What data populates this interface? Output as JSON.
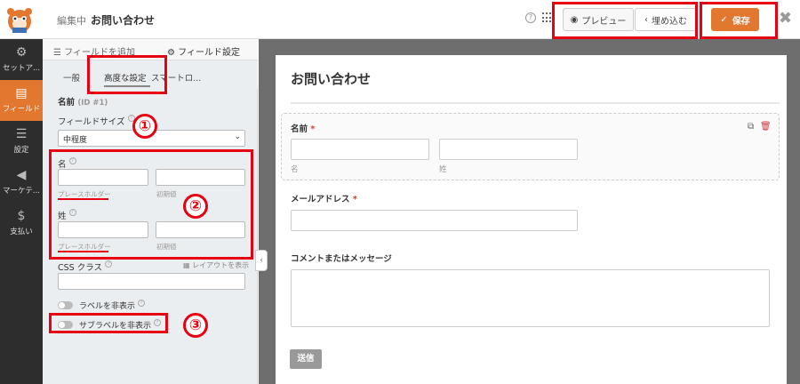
{
  "topbar": {
    "title_prefix": "編集中",
    "title": "お問い合わせ",
    "help_icon": "?",
    "preview_label": "プレビュー",
    "embed_label": "埋め込む",
    "save_label": "保存",
    "close_glyph": "✖"
  },
  "leftnav": {
    "items": [
      {
        "label": "セットアップ",
        "icon": "gear-icon",
        "glyph": "⚙"
      },
      {
        "label": "フィールド",
        "icon": "fields-icon",
        "glyph": "▤"
      },
      {
        "label": "設定",
        "icon": "sliders-icon",
        "glyph": "☰"
      },
      {
        "label": "マーケティング",
        "icon": "megaphone-icon",
        "glyph": "📢"
      },
      {
        "label": "支払い",
        "icon": "dollar-icon",
        "glyph": "$"
      }
    ]
  },
  "panel": {
    "tab_add": "フィールドを追加",
    "tab_settings": "フィールド設定",
    "subtabs": [
      "一般",
      "高度な設定",
      "スマートロ..."
    ],
    "field_name": "名前",
    "field_id": "(ID #1)",
    "field_size_label": "フィールドサイズ",
    "field_size_value": "中程度",
    "first_label": "名",
    "last_label": "姓",
    "placeholder_label": "プレースホルダー",
    "default_label": "初期値",
    "css_label": "CSS クラス",
    "layout_link": "レイアウトを表示",
    "hide_label": "ラベルを非表示",
    "hide_sublabels": "サブラベルを非表示",
    "help_glyph": "?"
  },
  "preview": {
    "form_title": "お問い合わせ",
    "name_label": "名前",
    "required_mark": "*",
    "first_sub": "名",
    "last_sub": "姓",
    "email_label": "メールアドレス",
    "comment_label": "コメントまたはメッセージ",
    "submit_label": "送信"
  },
  "annotations": {
    "marker_1": "①",
    "marker_2": "②",
    "marker_3": "③",
    "color": "#e60012"
  },
  "colors": {
    "accent": "#e27730",
    "nav_bg": "#2d2d2d",
    "preview_bg": "#6e6e6e"
  }
}
